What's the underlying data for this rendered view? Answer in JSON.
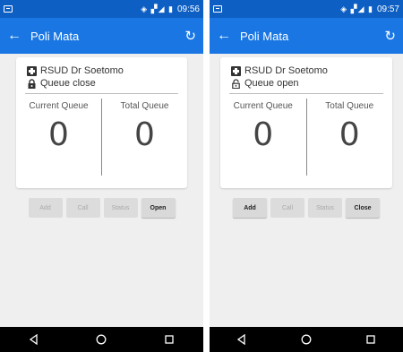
{
  "screens": [
    {
      "status_time": "09:56",
      "app_title": "Poli Mata",
      "hospital": "RSUD Dr Soetomo",
      "queue_status": "Queue close",
      "current_label": "Current Queue",
      "current_value": "0",
      "total_label": "Total Queue",
      "total_value": "0",
      "buttons": {
        "add": "Add",
        "call": "Call",
        "status": "Status",
        "toggle": "Open"
      }
    },
    {
      "status_time": "09:57",
      "app_title": "Poli Mata",
      "hospital": "RSUD Dr Soetomo",
      "queue_status": "Queue open",
      "current_label": "Current Queue",
      "current_value": "0",
      "total_label": "Total Queue",
      "total_value": "0",
      "buttons": {
        "add": "Add",
        "call": "Call",
        "status": "Status",
        "toggle": "Close"
      }
    }
  ],
  "colors": {
    "statusbar": "#0d5fc4",
    "appbar": "#1976e3",
    "background": "#efefef"
  },
  "icons": [
    "notification-icon",
    "back-arrow-icon",
    "refresh-icon",
    "hospital-plus-icon",
    "lock-closed-icon",
    "lock-open-icon",
    "nav-back-icon",
    "nav-home-icon",
    "nav-recents-icon"
  ]
}
